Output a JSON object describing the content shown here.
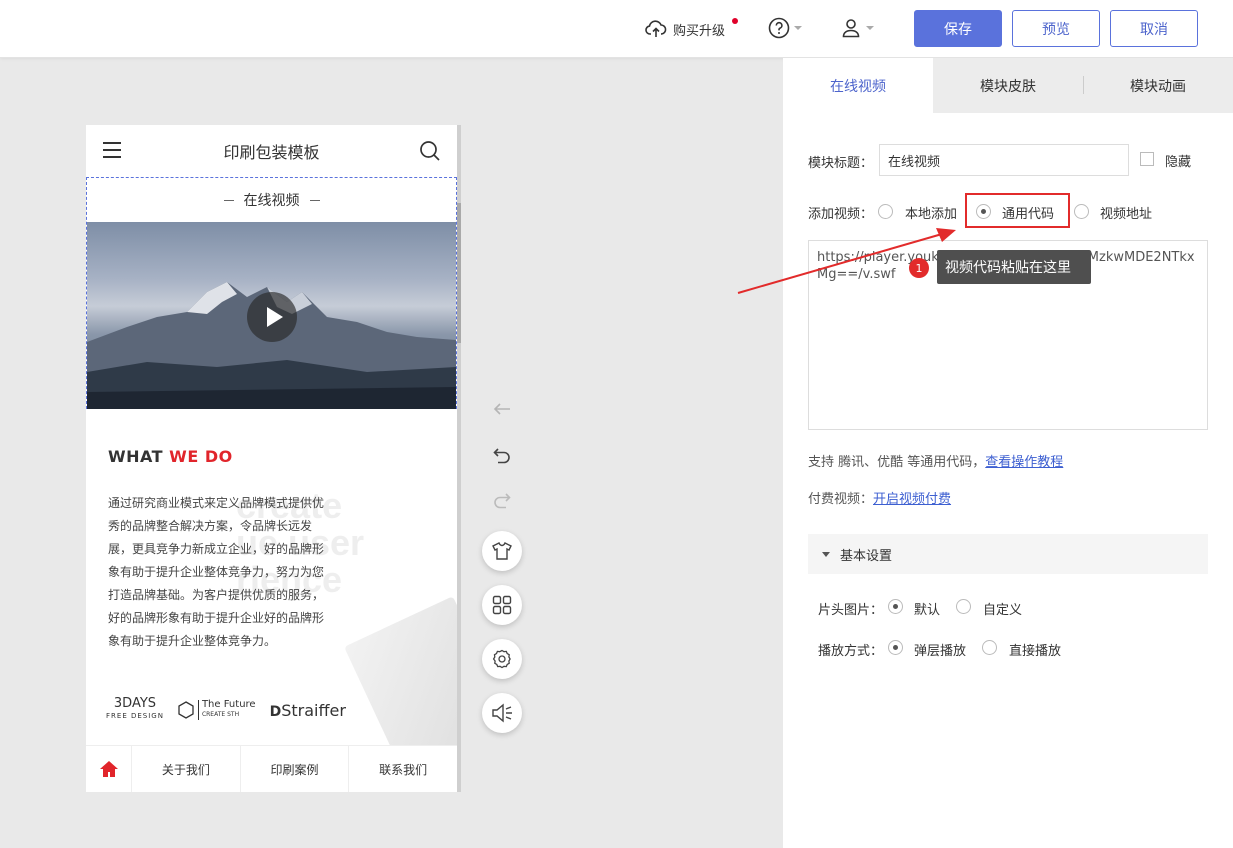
{
  "topbar": {
    "upgrade_label": "购买升级",
    "save_label": "保存",
    "preview_label": "预览",
    "cancel_label": "取消"
  },
  "phone": {
    "title": "印刷包装模板",
    "video_module_title": "在线视频",
    "what_we_do": {
      "part1": "WHAT",
      "part2": "WE DO"
    },
    "bg_text": [
      "create",
      "ue user",
      "rience"
    ],
    "description": "通过研究商业模式来定义品牌模式提供优秀的品牌整合解决方案，令品牌长远发展，更具竞争力新成立企业，好的品牌形象有助于提升企业整体竞争力，努力为您打造品牌基础。为客户提供优质的服务，好的品牌形象有助于提升企业好的品牌形象有助于提升企业整体竞争力。",
    "logos": {
      "logo1_main": "3DAYS",
      "logo1_sub": "FREE DESIGN",
      "logo2_main": "The Future",
      "logo2_sub": "CREATE STH",
      "logo3": "Straiffer"
    },
    "nav": [
      "关于我们",
      "印刷案例",
      "联系我们"
    ]
  },
  "panel": {
    "tabs": [
      "在线视频",
      "模块皮肤",
      "模块动画"
    ],
    "module_title_label": "模块标题：",
    "module_title_value": "在线视频",
    "hide_label": "隐藏",
    "add_video_label": "添加视频：",
    "add_options": [
      "本地添加",
      "通用代码",
      "视频地址"
    ],
    "selected_add_option": "通用代码",
    "code_value": "https://player.youku.com/player.php/sid/XMzkwMDE2NTkxMg==/v.swf",
    "support_text": "支持 腾讯、优酷 等通用代码，",
    "support_link": "查看操作教程",
    "paid_label": "付费视频：",
    "paid_link": "开启视频付费",
    "section_title": "基本设置",
    "cover_label": "片头图片：",
    "cover_options": [
      "默认",
      "自定义"
    ],
    "play_label": "播放方式：",
    "play_options": [
      "弹层播放",
      "直接播放"
    ]
  },
  "annotation": {
    "badge": "1",
    "tooltip": "视频代码粘贴在这里"
  },
  "colors": {
    "accent": "#5a72dc",
    "highlight_red": "#e22b2b",
    "brand_red": "#e1252b"
  }
}
